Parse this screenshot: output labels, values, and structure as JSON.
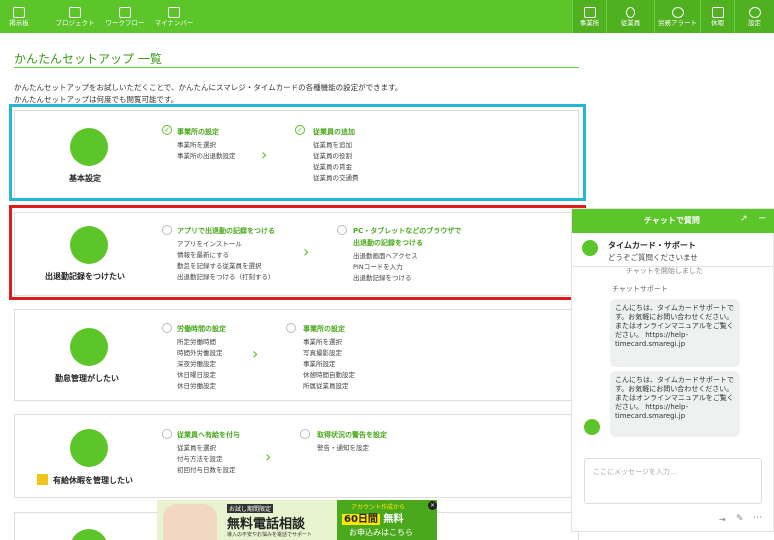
{
  "nav_left": [
    {
      "label": "掲示板",
      "icon": "board-icon"
    },
    {
      "label": "プロジェクト",
      "icon": "flag-icon"
    },
    {
      "label": "ワークフロー",
      "icon": "document-icon"
    },
    {
      "label": "マイナンバー",
      "icon": "id-card-icon"
    }
  ],
  "nav_right": [
    {
      "label": "事業所",
      "icon": "home-icon"
    },
    {
      "label": "従業員",
      "icon": "person-icon"
    },
    {
      "label": "労務アラート",
      "icon": "alert-icon"
    },
    {
      "label": "休暇",
      "icon": "vacation-icon"
    },
    {
      "label": "設定",
      "icon": "gear-icon"
    }
  ],
  "page": {
    "title": "かんたんセットアップ 一覧",
    "intro1": "かんたんセットアップをお試しいただくことで、かんたんにスマレジ・タイムカードの各種機能の設定ができます。",
    "intro2": "かんたんセットアップは何度でも閲覧可能です。"
  },
  "cards": [
    {
      "name": "基本設定",
      "icon": "beginner-mark-icon",
      "s1": {
        "title": "事業所の設定",
        "done": true,
        "items": [
          "事業所を選択",
          "事業所の出退勤設定"
        ]
      },
      "s2": {
        "title": "従業員の追加",
        "done": true,
        "items": [
          "従業員を追加",
          "従業員の役割",
          "従業員の賃金",
          "従業員の交通費"
        ]
      }
    },
    {
      "name": "出退勤記録をつけたい",
      "icon": "timecard-icon",
      "s1": {
        "title": "アプリで出退勤の記録をつける",
        "done": false,
        "items": [
          "アプリをインストール",
          "情報を最新にする",
          "勤怠を記録する従業員を選択",
          "出退勤記録をつける（打刻する）"
        ]
      },
      "s2": {
        "title": "PC・タブレットなどのブラウザで",
        "title2": "出退勤の記録をつける",
        "done": false,
        "items": [
          "出退勤画面へアクセス",
          "PINコードを入力",
          "出退勤記録をつける"
        ]
      }
    },
    {
      "name": "勤怠管理がしたい",
      "icon": "clock-icon",
      "s1": {
        "title": "労働時間の設定",
        "done": false,
        "items": [
          "所定労働時間",
          "時間外労働設定",
          "深夜労働設定",
          "休日曜日設定",
          "休日労働設定"
        ]
      },
      "s2": {
        "title": "事業所の設定",
        "done": false,
        "items": [
          "事業所を選択",
          "写真撮影設定",
          "事業所設定",
          "休憩時間自動設定",
          "所属従業員設定"
        ]
      }
    },
    {
      "name": "有給休暇を管理したい",
      "icon": "umbrella-icon",
      "s1": {
        "title": "従業員へ有給を付与",
        "done": false,
        "items": [
          "従業員を選択",
          "付与方法を設定",
          "初回付与日数を設定"
        ]
      },
      "s2": {
        "title": "取得状況の警告を設定",
        "done": false,
        "items": [
          "警告・通知を設定"
        ]
      }
    }
  ],
  "colors": {
    "brand": "#5cc52a",
    "highlight_blue": "#27b5d6",
    "highlight_red": "#e01b1b"
  },
  "chat": {
    "header": "チャットで質問",
    "expand_icon": "↗",
    "minimize_icon": "−",
    "agent_name": "タイムカード・サポート",
    "agent_sub": "どうぞご質問くださいませ",
    "system_msg": "チャットを開始しました",
    "agent_label": "チャットサポート",
    "msg1": "こんにちは、タイムカードサポートです。お気軽にお問い合わせください。またはオンラインマニュアルをご覧ください。 https://help-timecard.smaregi.jp",
    "msg2": "こんにちは、タイムカードサポートです。お気軽にお問い合わせください。またはオンラインマニュアルをご覧ください。 https://help-timecard.smaregi.jp",
    "placeholder": "ここにメッセージを入力..."
  },
  "ad": {
    "tag": "お試し期間限定",
    "main": "無料電話相談",
    "sub": "導入の不安やお悩みを電話でサポート",
    "badge": "アカウント作成から",
    "days": "60日間",
    "free": "無料",
    "cta": "お申込みはこちら"
  }
}
